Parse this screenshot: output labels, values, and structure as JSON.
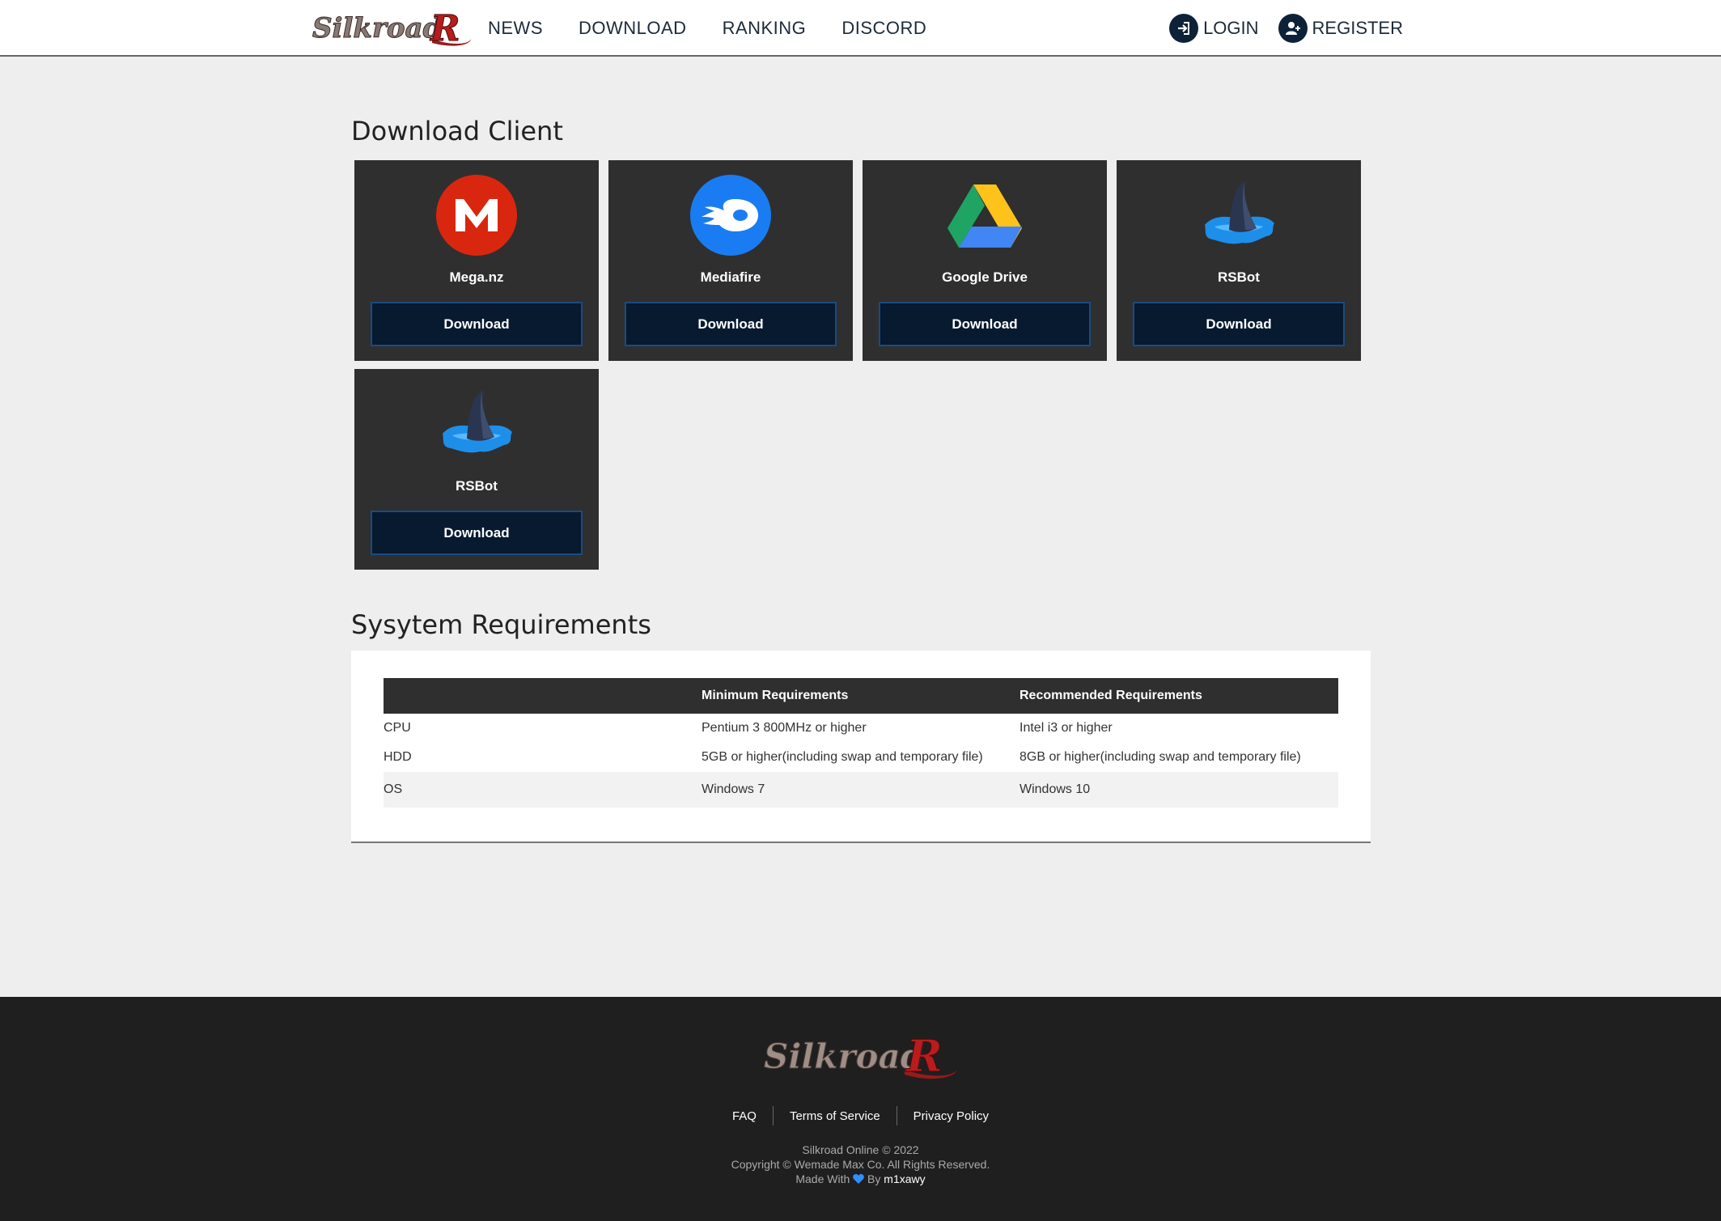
{
  "nav": {
    "logo_text": "SilkroadR",
    "links": [
      "NEWS",
      "DOWNLOAD",
      "RANKING",
      "DISCORD"
    ],
    "login": "LOGIN",
    "register": "REGISTER"
  },
  "download": {
    "title": "Download Client",
    "cards": [
      {
        "name": "Mega.nz",
        "button": "Download",
        "icon": "mega-icon"
      },
      {
        "name": "Mediafire",
        "button": "Download",
        "icon": "mediafire-icon"
      },
      {
        "name": "Google Drive",
        "button": "Download",
        "icon": "google-drive-icon"
      },
      {
        "name": "RSBot",
        "button": "Download",
        "icon": "rsbot-icon"
      },
      {
        "name": "RSBot",
        "button": "Download",
        "icon": "rsbot-icon"
      }
    ]
  },
  "requirements": {
    "title": "Sysytem Requirements",
    "headers": [
      "",
      "Minimum Requirements",
      "Recommended Requirements"
    ],
    "rows": [
      [
        "CPU",
        "Pentium 3 800MHz or higher",
        "Intel i3 or higher"
      ],
      [
        "HDD",
        "5GB or higher(including swap and temporary file)",
        "8GB or higher(including swap and temporary file)"
      ],
      [
        "OS",
        "Windows 7",
        "Windows 10"
      ]
    ]
  },
  "footer": {
    "logo_text": "SilkroadR",
    "links": [
      "FAQ",
      "Terms of Service",
      "Privacy Policy"
    ],
    "line1": "Silkroad Online © 2022",
    "line2": "Copyright © Wemade Max Co. All Rights Reserved.",
    "made_with": "Made With",
    "by": "By",
    "author": "m1xawy"
  },
  "colors": {
    "card_bg": "#2f2f2f",
    "button_bg": "#071a30",
    "button_border": "#1a4b82",
    "footer_bg": "#1f1f1f",
    "heart": "#2f8fff"
  }
}
